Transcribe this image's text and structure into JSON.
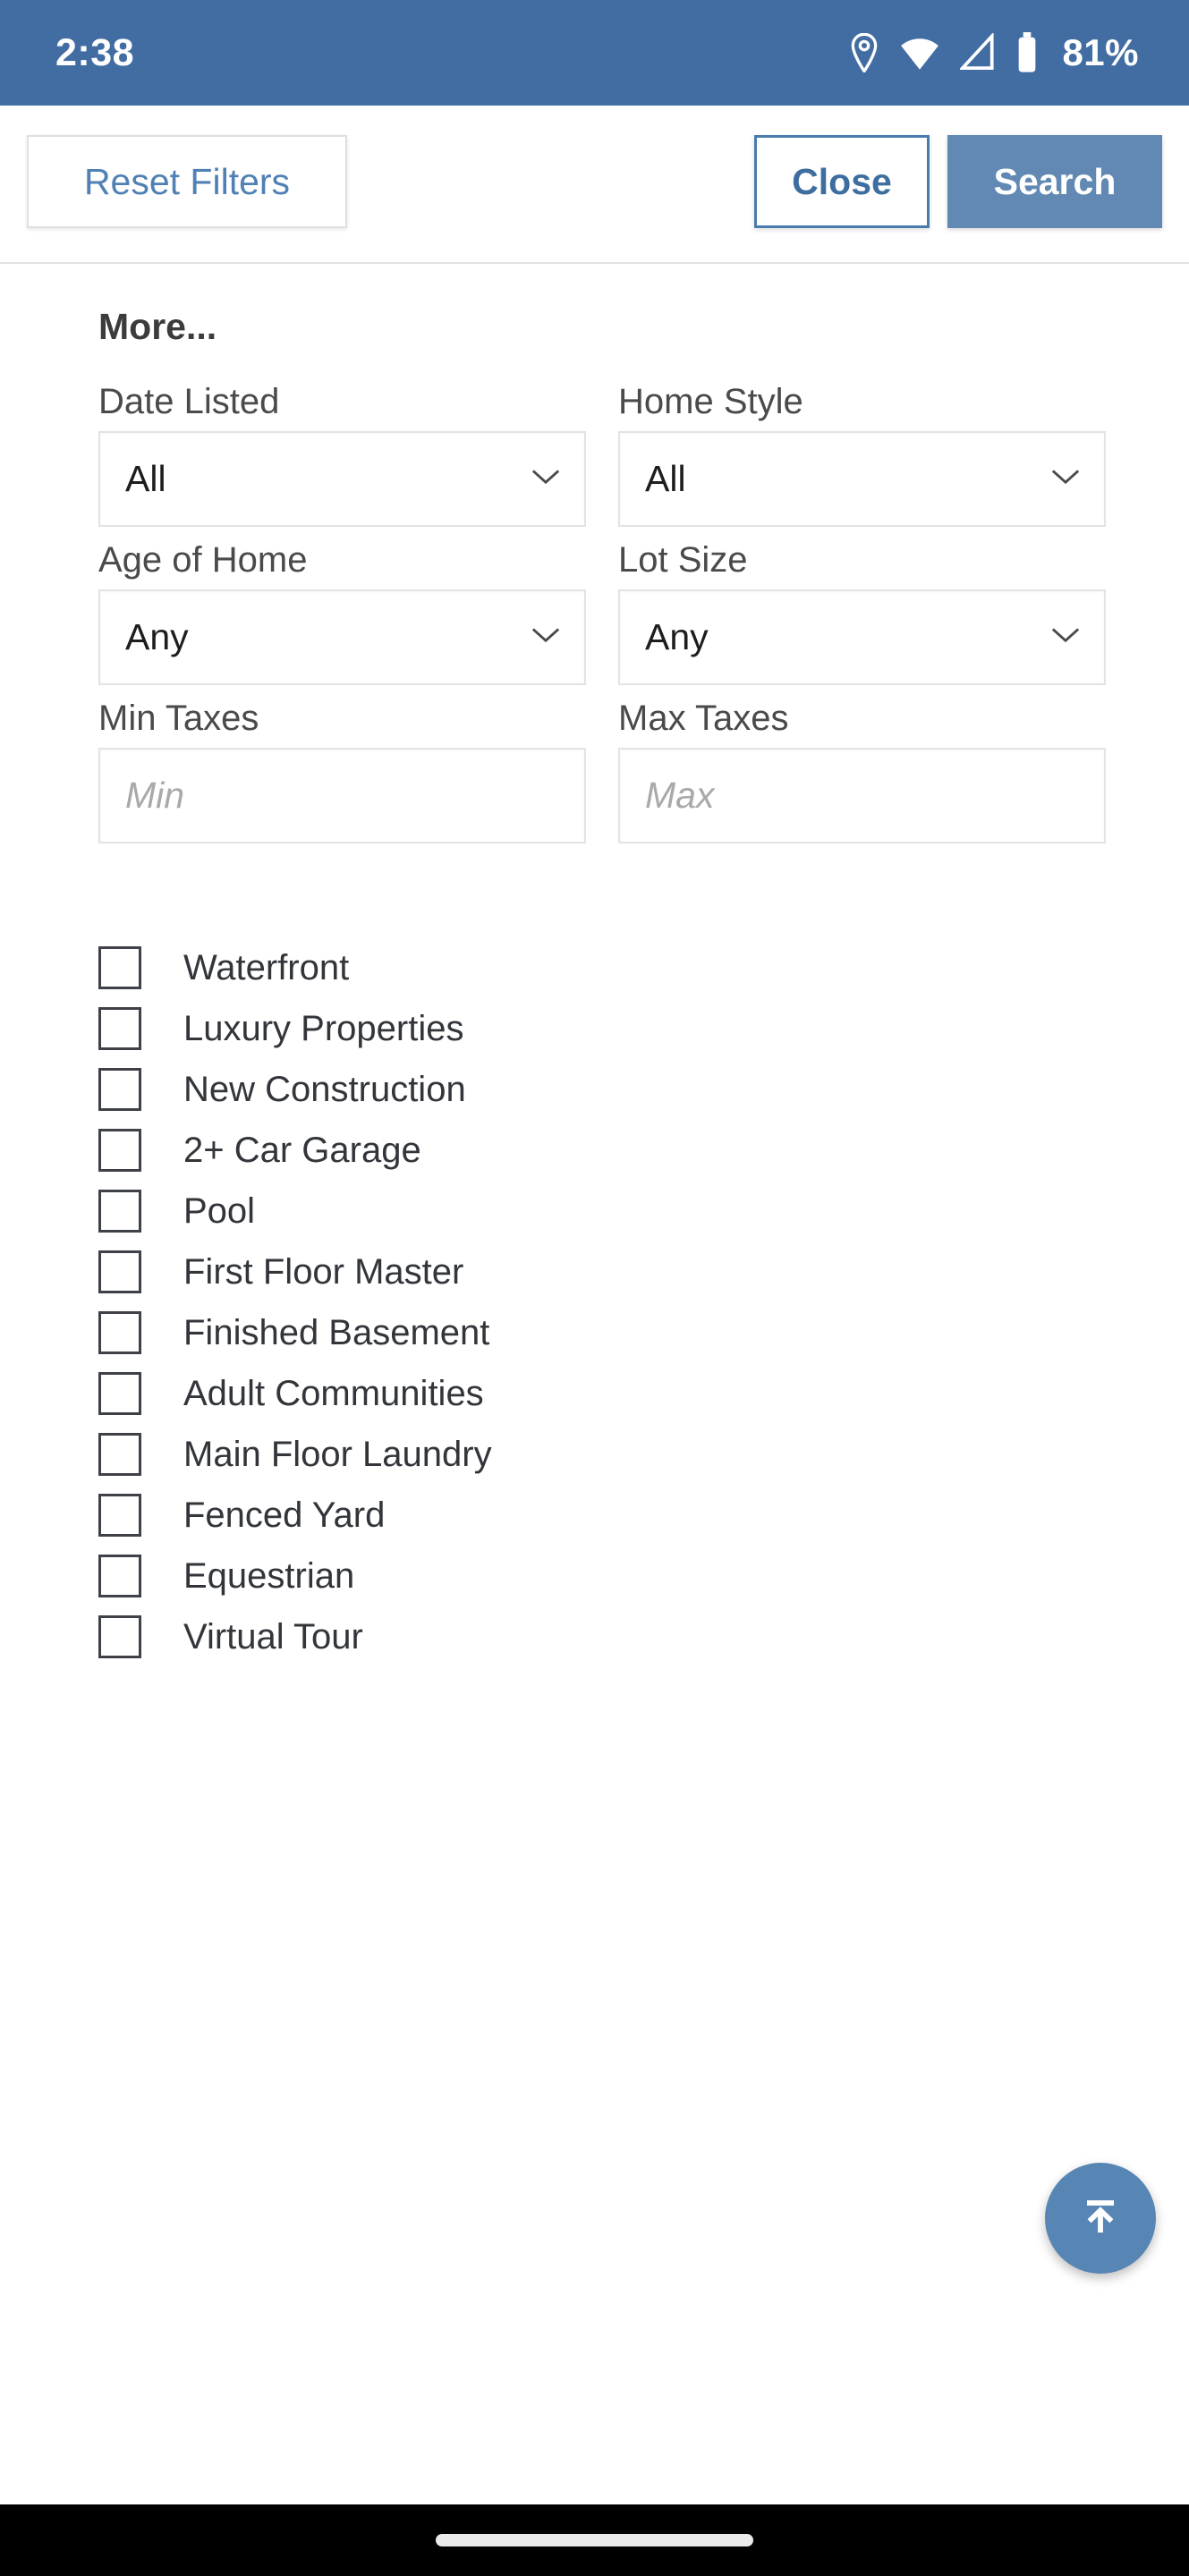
{
  "status_bar": {
    "time": "2:38",
    "battery_percent": "81%",
    "icons": [
      "location-pin-icon",
      "wifi-icon",
      "cell-signal-icon",
      "battery-icon"
    ],
    "background_color": "#426da2",
    "foreground_color": "#ffffff"
  },
  "toolbar": {
    "reset_label": "Reset Filters",
    "close_label": "Close",
    "search_label": "Search",
    "reset_text_color": "#5081b5",
    "close_text_color": "#3d6e9f",
    "search_background_color": "#6189b4"
  },
  "panel": {
    "title": "More...",
    "fields": [
      {
        "label": "Date Listed",
        "type": "select",
        "value": "All"
      },
      {
        "label": "Home Style",
        "type": "select",
        "value": "All"
      },
      {
        "label": "Age of Home",
        "type": "select",
        "value": "Any"
      },
      {
        "label": "Lot Size",
        "type": "select",
        "value": "Any"
      },
      {
        "label": "Min Taxes",
        "type": "text",
        "value": "",
        "placeholder": "Min"
      },
      {
        "label": "Max Taxes",
        "type": "text",
        "value": "",
        "placeholder": "Max"
      }
    ],
    "checkboxes": [
      {
        "label": "Waterfront",
        "checked": false
      },
      {
        "label": "Luxury Properties",
        "checked": false
      },
      {
        "label": "New Construction",
        "checked": false
      },
      {
        "label": "2+ Car Garage",
        "checked": false
      },
      {
        "label": "Pool",
        "checked": false
      },
      {
        "label": "First Floor Master",
        "checked": false
      },
      {
        "label": "Finished Basement",
        "checked": false
      },
      {
        "label": "Adult Communities",
        "checked": false
      },
      {
        "label": "Main Floor Laundry",
        "checked": false
      },
      {
        "label": "Fenced Yard",
        "checked": false
      },
      {
        "label": "Equestrian",
        "checked": false
      },
      {
        "label": "Virtual Tour",
        "checked": false
      }
    ]
  },
  "fab": {
    "icon": "arrow-to-top-icon",
    "background_color": "#5886b4"
  },
  "nav_bar": {
    "gesture_pill": "home-gesture-pill",
    "background_color": "#000000"
  }
}
